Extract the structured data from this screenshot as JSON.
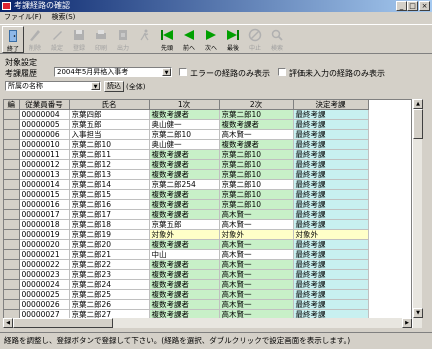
{
  "window": {
    "title": "考課経路の確認",
    "buttons": [
      "_",
      "□",
      "×"
    ]
  },
  "menu": [
    "ファイル(F)",
    "検索(S)"
  ],
  "toolbar": [
    {
      "label": "終了",
      "icon": "exit-door-icon",
      "enabled": true
    },
    {
      "label": "削除",
      "icon": "delete-icon",
      "enabled": false
    },
    {
      "label": "設定",
      "icon": "edit-pen-icon",
      "enabled": false
    },
    {
      "label": "登録",
      "icon": "save-disk-icon",
      "enabled": false
    },
    {
      "label": "印刷",
      "icon": "print-icon",
      "enabled": false
    },
    {
      "label": "出力",
      "icon": "export-icon",
      "enabled": false
    },
    {
      "label": "",
      "icon": "run-person-icon",
      "enabled": false
    },
    {
      "label": "先頭",
      "icon": "first-record-icon",
      "enabled": true
    },
    {
      "label": "前へ",
      "icon": "previous-record-icon",
      "enabled": true
    },
    {
      "label": "次へ",
      "icon": "next-record-icon",
      "enabled": true
    },
    {
      "label": "最後",
      "icon": "last-record-icon",
      "enabled": true
    },
    {
      "label": "中止",
      "icon": "stop-icon",
      "enabled": false
    },
    {
      "label": "検索",
      "icon": "search-icon",
      "enabled": false
    }
  ],
  "filter": {
    "section_label": "対象設定",
    "history_label": "考課履歴",
    "history_value": "2004年5月昇格入事考",
    "error_only_label": "エラーの経路のみ表示",
    "unrated_only_label": "評価未入力の経路のみ表示",
    "dept_select": "所属の名称",
    "load_button": "読込",
    "dept_scope": "(全体)"
  },
  "table": {
    "columns": [
      "編",
      "従業員番号",
      "氏名",
      "1次",
      "2次",
      "決定考課"
    ],
    "rows": [
      [
        "00000004",
        "京葉四郎",
        "複数考課者",
        "京葉二郎10",
        "最終考課",
        "g"
      ],
      [
        "00000005",
        "京葉五郎",
        "奥山健一",
        "複数考課者",
        "最終考課",
        "wg"
      ],
      [
        "00000006",
        "入事担当",
        "京葉二郎10",
        "高木賢一",
        "最終考課",
        "w"
      ],
      [
        "00000010",
        "京葉二郎10",
        "奥山健一",
        "複数考課者",
        "最終考課",
        "wg"
      ],
      [
        "00000011",
        "京葉二郎11",
        "複数考課者",
        "京葉二郎10",
        "最終考課",
        "g"
      ],
      [
        "00000012",
        "京葉二郎12",
        "複数考課者",
        "京葉二郎10",
        "最終考課",
        "g"
      ],
      [
        "00000013",
        "京葉二郎13",
        "複数考課者",
        "京葉二郎10",
        "最終考課",
        "g"
      ],
      [
        "00000014",
        "京葉二郎14",
        "京葉二郎254",
        "京葉二郎10",
        "最終考課",
        "w"
      ],
      [
        "00000015",
        "京葉二郎15",
        "複数考課者",
        "京葉二郎10",
        "最終考課",
        "g"
      ],
      [
        "00000016",
        "京葉二郎16",
        "複数考課者",
        "京葉二郎10",
        "最終考課",
        "g"
      ],
      [
        "00000017",
        "京葉二郎17",
        "複数考課者",
        "高木賢一",
        "最終考課",
        "g"
      ],
      [
        "00000018",
        "京葉二郎18",
        "京葉五郎",
        "高木賢一",
        "最終考課",
        "w"
      ],
      [
        "00000019",
        "京葉二郎19",
        "対象外",
        "対象外",
        "対象外",
        "y"
      ],
      [
        "00000020",
        "京葉二郎20",
        "複数考課者",
        "高木賢一",
        "最終考課",
        "g"
      ],
      [
        "00000021",
        "京葉二郎21",
        "中山",
        "高木賢一",
        "最終考課",
        "w"
      ],
      [
        "00000022",
        "京葉二郎22",
        "複数考課者",
        "高木賢一",
        "最終考課",
        "g"
      ],
      [
        "00000023",
        "京葉二郎23",
        "複数考課者",
        "高木賢一",
        "最終考課",
        "g"
      ],
      [
        "00000024",
        "京葉二郎24",
        "複数考課者",
        "高木賢一",
        "最終考課",
        "g"
      ],
      [
        "00000025",
        "京葉二郎25",
        "複数考課者",
        "高木賢一",
        "最終考課",
        "g"
      ],
      [
        "00000026",
        "京葉二郎26",
        "複数考課者",
        "高木賢一",
        "最終考課",
        "g"
      ],
      [
        "00000027",
        "京葉二郎27",
        "複数考課者",
        "高木賢一",
        "最終考課",
        "g"
      ]
    ]
  },
  "status": "経路を調整し、登録ボタンで登録して下さい。(経路を選択、ダブルクリックで設定画面を表示します。)"
}
